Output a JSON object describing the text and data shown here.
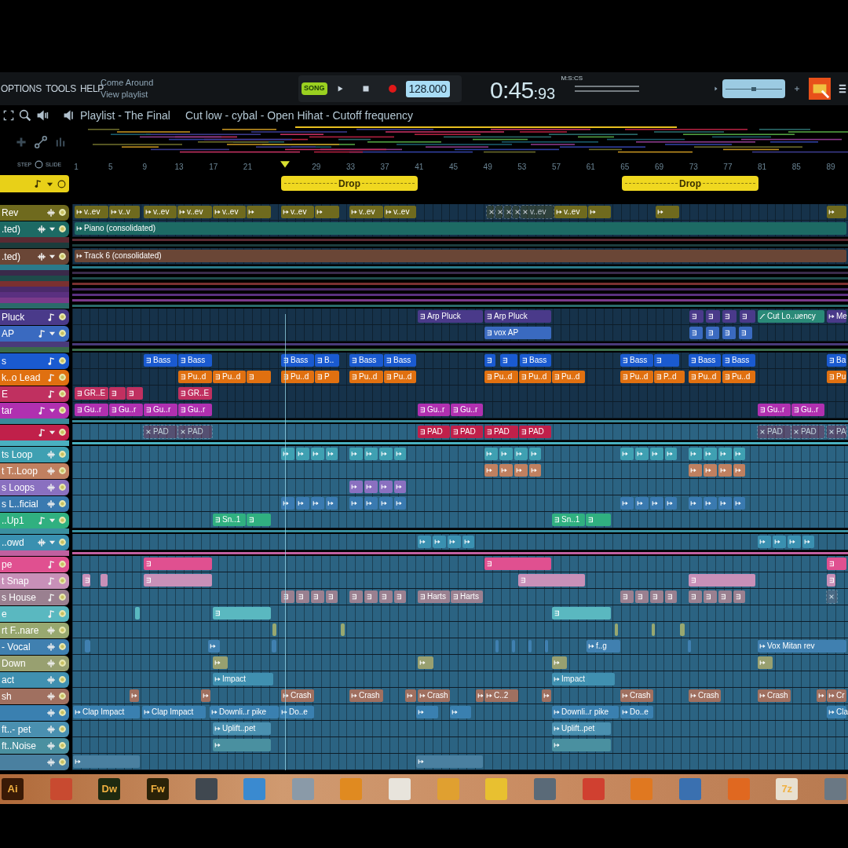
{
  "menu": [
    "OPTIONS",
    "TOOLS",
    "HELP"
  ],
  "hint": {
    "title": "Come Around",
    "subtitle": "View playlist"
  },
  "pitch": {
    "level": 0.5
  },
  "transport": {
    "mode": "SONG",
    "tempo": "128.000",
    "time": "0:45",
    "time_cs": ":93",
    "time_unit": "M:S:CS"
  },
  "playlist": {
    "title": "Playlist - The Final",
    "hint": "Cut low - cybal - Open Hihat - Cutoff frequency"
  },
  "ruler": {
    "step_label": "STEP",
    "slide_label": "SLIDE",
    "bars": [
      "1",
      "5",
      "9",
      "13",
      "17",
      "21",
      "29",
      "33",
      "37",
      "41",
      "45",
      "49",
      "53",
      "57",
      "61",
      "65",
      "69",
      "73",
      "77",
      "81",
      "85",
      "89"
    ]
  },
  "markers": [
    {
      "label": "Drop"
    },
    {
      "label": "Drop"
    }
  ],
  "tracks": [
    {
      "kind": "audio",
      "name": "Rev",
      "color": "#6f6a1e",
      "dropdown": false,
      "clips": [
        {
          "kind": "audio",
          "muted": false,
          "label": "v..ev"
        },
        {
          "kind": "audio",
          "muted": false,
          "label": "v..v"
        },
        {
          "kind": "audio",
          "muted": false,
          "label": "v..ev"
        },
        {
          "kind": "audio",
          "muted": false,
          "label": "v..ev"
        },
        {
          "kind": "audio",
          "muted": false,
          "label": "v..ev"
        },
        {
          "kind": "audio",
          "muted": false
        },
        {
          "kind": "audio",
          "muted": false,
          "label": "v..ev"
        },
        {
          "kind": "audio",
          "muted": false
        },
        {
          "kind": "audio",
          "muted": false,
          "label": "v..ev"
        },
        {
          "kind": "audio",
          "muted": false,
          "label": "v..ev"
        },
        {
          "kind": "audio",
          "muted": true
        },
        {
          "kind": "audio",
          "muted": true
        },
        {
          "kind": "audio",
          "muted": true
        },
        {
          "kind": "audio",
          "muted": true
        },
        {
          "kind": "audio",
          "muted": true,
          "label": "v..ev"
        },
        {
          "kind": "audio",
          "muted": false,
          "label": "v..ev"
        },
        {
          "kind": "audio",
          "muted": false
        },
        {
          "kind": "audio",
          "muted": false
        },
        {
          "kind": "audio",
          "muted": false
        }
      ]
    },
    {
      "kind": "audio",
      "name": ".ted)",
      "color": "#1d6a64",
      "dropdown": true,
      "clips": [
        {
          "kind": "audio",
          "muted": false,
          "label": "Piano (consolidated)"
        }
      ]
    },
    {
      "kind": "strip",
      "color": "#5a2a32"
    },
    {
      "kind": "strip",
      "color": "#1c3c3c"
    },
    {
      "kind": "audio",
      "name": ".ted)",
      "color": "#6a4636",
      "dropdown": true,
      "clips": [
        {
          "kind": "audio",
          "muted": false,
          "label": "Track 6 (consolidated)"
        }
      ]
    },
    {
      "kind": "strip",
      "color": "#2a7a8a"
    },
    {
      "kind": "strip",
      "color": "#3a2a4a"
    },
    {
      "kind": "strip",
      "color": "#1f4a4a"
    },
    {
      "kind": "strip",
      "color": "#7a3030"
    },
    {
      "kind": "strip",
      "color": "#4a2a6a"
    },
    {
      "kind": "strip",
      "color": "#5a3080"
    },
    {
      "kind": "strip",
      "color": "#7a3a8a"
    },
    {
      "kind": "strip",
      "color": "#2a6a6a"
    },
    {
      "kind": "pattern",
      "name": "Pluck",
      "color": "#4a3a8a",
      "dropdown": false,
      "clips": [
        {
          "kind": "pattern",
          "muted": false,
          "label": "Arp Pluck"
        },
        {
          "kind": "pattern",
          "muted": false,
          "label": "Arp Pluck"
        },
        {
          "kind": "pattern",
          "muted": false
        },
        {
          "kind": "pattern",
          "muted": false
        },
        {
          "kind": "pattern",
          "muted": false
        },
        {
          "kind": "pattern",
          "muted": false
        },
        {
          "kind": "automation",
          "muted": false,
          "label": "Cut Lo..uency"
        },
        {
          "kind": "audio",
          "muted": false,
          "label": "Me"
        }
      ]
    },
    {
      "kind": "pattern",
      "name": "AP",
      "color": "#3a6ac0",
      "dropdown": true,
      "clips": [
        {
          "kind": "pattern",
          "muted": false,
          "label": "vox AP"
        },
        {
          "kind": "pattern",
          "muted": false
        },
        {
          "kind": "pattern",
          "muted": false
        },
        {
          "kind": "pattern",
          "muted": false
        },
        {
          "kind": "pattern",
          "muted": false
        }
      ]
    },
    {
      "kind": "strip",
      "color": "#4a3a7a"
    },
    {
      "kind": "strip",
      "color": "#3a6a4a"
    },
    {
      "kind": "pattern",
      "name": "s",
      "color": "#1a5ad0",
      "dropdown": false,
      "clips": [
        {
          "kind": "pattern",
          "muted": false,
          "label": "Bass"
        },
        {
          "kind": "pattern",
          "muted": false,
          "label": "Bass"
        },
        {
          "kind": "pattern",
          "muted": false,
          "label": "Bass"
        },
        {
          "kind": "pattern",
          "muted": false,
          "label": "B.."
        },
        {
          "kind": "pattern",
          "muted": false,
          "label": "Bass"
        },
        {
          "kind": "pattern",
          "muted": false,
          "label": "Bass"
        },
        {
          "kind": "pattern",
          "muted": false
        },
        {
          "kind": "pattern",
          "muted": false
        },
        {
          "kind": "pattern",
          "muted": false,
          "label": "Bass"
        },
        {
          "kind": "pattern",
          "muted": false,
          "label": "Bass"
        },
        {
          "kind": "pattern",
          "muted": false
        },
        {
          "kind": "pattern",
          "muted": false,
          "label": "Bass"
        },
        {
          "kind": "pattern",
          "muted": false,
          "label": "Bass"
        },
        {
          "kind": "pattern",
          "muted": false,
          "label": "Ba"
        }
      ]
    },
    {
      "kind": "pattern",
      "name": "k..o Lead",
      "color": "#e07010",
      "dropdown": false,
      "clips": [
        {
          "kind": "pattern",
          "muted": false,
          "label": "Pu..d"
        },
        {
          "kind": "pattern",
          "muted": false,
          "label": "Pu..d"
        },
        {
          "kind": "pattern",
          "muted": false
        },
        {
          "kind": "pattern",
          "muted": false,
          "label": "Pu..d"
        },
        {
          "kind": "pattern",
          "muted": false,
          "label": "P"
        },
        {
          "kind": "pattern",
          "muted": false,
          "label": "Pu..d"
        },
        {
          "kind": "pattern",
          "muted": false,
          "label": "Pu..d"
        },
        {
          "kind": "pattern",
          "muted": false,
          "label": "Pu..d"
        },
        {
          "kind": "pattern",
          "muted": false,
          "label": "Pu..d"
        },
        {
          "kind": "pattern",
          "muted": false,
          "label": "Pu..d"
        },
        {
          "kind": "pattern",
          "muted": false,
          "label": "Pu..d"
        },
        {
          "kind": "pattern",
          "muted": false,
          "label": "P..d"
        },
        {
          "kind": "pattern",
          "muted": false,
          "label": "Pu..d"
        },
        {
          "kind": "pattern",
          "muted": false,
          "label": "Pu..d"
        },
        {
          "kind": "pattern",
          "muted": false,
          "label": "Pu"
        }
      ]
    },
    {
      "kind": "pattern",
      "name": "E",
      "color": "#c03060",
      "dropdown": false,
      "clips": [
        {
          "kind": "pattern",
          "muted": false,
          "label": "GR..E"
        },
        {
          "kind": "pattern",
          "muted": false
        },
        {
          "kind": "pattern",
          "muted": false
        },
        {
          "kind": "pattern",
          "muted": false,
          "label": "GR..E"
        }
      ]
    },
    {
      "kind": "pattern",
      "name": "tar",
      "color": "#b030b0",
      "dropdown": true,
      "clips": [
        {
          "kind": "pattern",
          "muted": false,
          "label": "Gu..r"
        },
        {
          "kind": "pattern",
          "muted": false,
          "label": "Gu..r"
        },
        {
          "kind": "pattern",
          "muted": false,
          "label": "Gu..r"
        },
        {
          "kind": "pattern",
          "muted": false,
          "label": "Gu..r"
        },
        {
          "kind": "pattern",
          "muted": false,
          "label": "Gu..r"
        },
        {
          "kind": "pattern",
          "muted": false,
          "label": "Gu..r"
        },
        {
          "kind": "pattern",
          "muted": false,
          "label": "Gu..r"
        },
        {
          "kind": "pattern",
          "muted": false,
          "label": "Gu..r"
        }
      ]
    },
    {
      "kind": "strip",
      "color": "#3a8a9a"
    },
    {
      "kind": "pattern",
      "color": "#c0204a",
      "dropdown": true,
      "clips": [
        {
          "kind": "pattern",
          "muted": true,
          "label": "PAD"
        },
        {
          "kind": "pattern",
          "muted": true,
          "label": "PAD"
        },
        {
          "kind": "pattern",
          "muted": false,
          "label": "PAD"
        },
        {
          "kind": "pattern",
          "muted": false,
          "label": "PAD"
        },
        {
          "kind": "pattern",
          "muted": false,
          "label": "PAD"
        },
        {
          "kind": "pattern",
          "muted": false,
          "label": "PAD"
        },
        {
          "kind": "pattern",
          "muted": true,
          "label": "PAD"
        },
        {
          "kind": "pattern",
          "muted": true,
          "label": "PAD"
        },
        {
          "kind": "pattern",
          "muted": true,
          "label": "PA"
        }
      ]
    },
    {
      "kind": "strip",
      "color": "#4ab0c0"
    },
    {
      "kind": "audio",
      "name": "ts Loop",
      "color": "#3fa0b2",
      "dropdown": false,
      "clips": [
        {
          "kind": "audio",
          "muted": false
        },
        {
          "kind": "audio",
          "muted": false
        },
        {
          "kind": "audio",
          "muted": false
        },
        {
          "kind": "audio",
          "muted": false
        },
        {
          "kind": "audio",
          "muted": false
        },
        {
          "kind": "audio",
          "muted": false
        },
        {
          "kind": "audio",
          "muted": false
        },
        {
          "kind": "audio",
          "muted": false
        },
        {
          "kind": "audio",
          "muted": false
        },
        {
          "kind": "audio",
          "muted": false
        },
        {
          "kind": "audio",
          "muted": false
        },
        {
          "kind": "audio",
          "muted": false
        },
        {
          "kind": "audio",
          "muted": false
        },
        {
          "kind": "audio",
          "muted": false
        },
        {
          "kind": "audio",
          "muted": false
        },
        {
          "kind": "audio",
          "muted": false
        },
        {
          "kind": "audio",
          "muted": false
        },
        {
          "kind": "audio",
          "muted": false
        },
        {
          "kind": "audio",
          "muted": false
        },
        {
          "kind": "audio",
          "muted": false
        }
      ]
    },
    {
      "kind": "audio",
      "name": "t T..Loop",
      "color": "#c08060",
      "dropdown": false,
      "clips": [
        {
          "kind": "audio",
          "muted": false
        },
        {
          "kind": "audio",
          "muted": false
        },
        {
          "kind": "audio",
          "muted": false
        },
        {
          "kind": "audio",
          "muted": false
        },
        {
          "kind": "audio",
          "muted": false
        },
        {
          "kind": "audio",
          "muted": false
        },
        {
          "kind": "audio",
          "muted": false
        },
        {
          "kind": "audio",
          "muted": false
        }
      ]
    },
    {
      "kind": "audio",
      "name": "s Loops",
      "color": "#8a70c0",
      "dropdown": false,
      "clips": [
        {
          "kind": "audio",
          "muted": false
        },
        {
          "kind": "audio",
          "muted": false
        },
        {
          "kind": "audio",
          "muted": false
        },
        {
          "kind": "audio",
          "muted": false
        }
      ]
    },
    {
      "kind": "audio",
      "name": "s L..ficial",
      "color": "#3a7ab0",
      "dropdown": false,
      "clips": [
        {
          "kind": "audio",
          "muted": false
        },
        {
          "kind": "audio",
          "muted": false
        },
        {
          "kind": "audio",
          "muted": false
        },
        {
          "kind": "audio",
          "muted": false
        },
        {
          "kind": "audio",
          "muted": false
        },
        {
          "kind": "audio",
          "muted": false
        },
        {
          "kind": "audio",
          "muted": false
        },
        {
          "kind": "audio",
          "muted": false
        },
        {
          "kind": "audio",
          "muted": false
        },
        {
          "kind": "audio",
          "muted": false
        },
        {
          "kind": "audio",
          "muted": false
        },
        {
          "kind": "audio",
          "muted": false
        },
        {
          "kind": "audio",
          "muted": false
        },
        {
          "kind": "audio",
          "muted": false
        },
        {
          "kind": "audio",
          "muted": false
        },
        {
          "kind": "audio",
          "muted": false
        }
      ]
    },
    {
      "kind": "pattern",
      "name": "..Up1",
      "color": "#30b080",
      "dropdown": true,
      "clips": [
        {
          "kind": "pattern",
          "muted": false,
          "label": "Sn..1"
        },
        {
          "kind": "pattern",
          "muted": false
        },
        {
          "kind": "pattern",
          "muted": false,
          "label": "Sn..1"
        },
        {
          "kind": "pattern",
          "muted": false
        }
      ]
    },
    {
      "kind": "strip",
      "color": "#3a90a0"
    },
    {
      "kind": "audio",
      "name": "..owd",
      "color": "#3a90b0",
      "dropdown": true,
      "clips": [
        {
          "kind": "audio",
          "muted": false
        },
        {
          "kind": "audio",
          "muted": false
        },
        {
          "kind": "audio",
          "muted": false
        },
        {
          "kind": "audio",
          "muted": false
        },
        {
          "kind": "audio",
          "muted": false
        },
        {
          "kind": "audio",
          "muted": false
        },
        {
          "kind": "audio",
          "muted": false
        },
        {
          "kind": "audio",
          "muted": false
        }
      ]
    },
    {
      "kind": "strip",
      "color": "#c060a0"
    },
    {
      "kind": "pattern",
      "name": "pe",
      "color": "#e05090",
      "dropdown": false,
      "clips": [
        {
          "kind": "pattern",
          "muted": false
        },
        {
          "kind": "pattern",
          "muted": false
        },
        {
          "kind": "pattern",
          "muted": false
        }
      ]
    },
    {
      "kind": "pattern",
      "name": "t Snap",
      "color": "#c890b8",
      "dropdown": false,
      "clips": [
        {
          "kind": "pattern",
          "muted": false
        },
        {
          "kind": "pattern",
          "muted": false
        },
        {
          "kind": "pattern",
          "muted": false
        },
        {
          "kind": "pattern",
          "muted": false
        },
        {
          "kind": "pattern",
          "muted": false
        },
        {
          "kind": "pattern",
          "muted": false
        }
      ]
    },
    {
      "kind": "pattern",
      "name": "s House",
      "color": "#9a8090",
      "dropdown": false,
      "clips": [
        {
          "kind": "pattern",
          "muted": false
        },
        {
          "kind": "pattern",
          "muted": false
        },
        {
          "kind": "pattern",
          "muted": false
        },
        {
          "kind": "pattern",
          "muted": false
        },
        {
          "kind": "pattern",
          "muted": false
        },
        {
          "kind": "pattern",
          "muted": false
        },
        {
          "kind": "pattern",
          "muted": false
        },
        {
          "kind": "pattern",
          "muted": false
        },
        {
          "kind": "pattern",
          "muted": false,
          "label": "Harts"
        },
        {
          "kind": "pattern",
          "muted": false,
          "label": "Harts"
        },
        {
          "kind": "pattern",
          "muted": false
        },
        {
          "kind": "pattern",
          "muted": false
        },
        {
          "kind": "pattern",
          "muted": false
        },
        {
          "kind": "pattern",
          "muted": false
        },
        {
          "kind": "pattern",
          "muted": false
        },
        {
          "kind": "pattern",
          "muted": false
        },
        {
          "kind": "pattern",
          "muted": false
        },
        {
          "kind": "pattern",
          "muted": false
        },
        {
          "kind": "pattern",
          "muted": true
        }
      ]
    },
    {
      "kind": "pattern",
      "name": "e",
      "color": "#5ab8c0",
      "dropdown": false,
      "clips": [
        {
          "kind": "pattern",
          "muted": false
        },
        {
          "kind": "pattern",
          "muted": false
        },
        {
          "kind": "pattern",
          "muted": false
        }
      ]
    },
    {
      "kind": "audio",
      "name": "rt F..nare",
      "color": "#98a870",
      "dropdown": false,
      "clips": [
        {
          "kind": "audio",
          "muted": false
        },
        {
          "kind": "audio",
          "muted": false
        },
        {
          "kind": "audio",
          "muted": false
        },
        {
          "kind": "audio",
          "muted": false
        },
        {
          "kind": "audio",
          "muted": false
        }
      ]
    },
    {
      "kind": "audio",
      "name": "- Vocal",
      "color": "#4080b0",
      "dropdown": false,
      "clips": [
        {
          "kind": "audio",
          "muted": false
        },
        {
          "kind": "audio",
          "muted": false
        },
        {
          "kind": "audio",
          "muted": false
        },
        {
          "kind": "audio",
          "muted": false
        },
        {
          "kind": "audio",
          "muted": false
        },
        {
          "kind": "audio",
          "muted": false
        },
        {
          "kind": "audio",
          "muted": false
        },
        {
          "kind": "audio",
          "muted": false,
          "label": "f..g"
        },
        {
          "kind": "audio",
          "muted": false
        },
        {
          "kind": "audio",
          "muted": false,
          "label": "Vox Mitan rev"
        }
      ]
    },
    {
      "kind": "audio",
      "name": "Down",
      "color": "#98a070",
      "dropdown": false,
      "clips": [
        {
          "kind": "audio",
          "muted": false
        },
        {
          "kind": "audio",
          "muted": false
        },
        {
          "kind": "audio",
          "muted": false
        },
        {
          "kind": "audio",
          "muted": false
        }
      ]
    },
    {
      "kind": "audio",
      "name": "act",
      "color": "#4090b0",
      "dropdown": false,
      "clips": [
        {
          "kind": "audio",
          "muted": false,
          "label": "Impact"
        },
        {
          "kind": "audio",
          "muted": false,
          "label": "Impact"
        }
      ]
    },
    {
      "kind": "audio",
      "name": "sh",
      "color": "#a07060",
      "dropdown": false,
      "clips": [
        {
          "kind": "audio",
          "muted": false
        },
        {
          "kind": "audio",
          "muted": false
        },
        {
          "kind": "audio",
          "muted": false,
          "label": "Crash"
        },
        {
          "kind": "audio",
          "muted": false,
          "label": "Crash"
        },
        {
          "kind": "audio",
          "muted": false
        },
        {
          "kind": "audio",
          "muted": false,
          "label": "Crash"
        },
        {
          "kind": "audio",
          "muted": false
        },
        {
          "kind": "audio",
          "muted": false,
          "label": "C..2"
        },
        {
          "kind": "audio",
          "muted": false
        },
        {
          "kind": "audio",
          "muted": false,
          "label": "Crash"
        },
        {
          "kind": "audio",
          "muted": false,
          "label": "Crash"
        },
        {
          "kind": "audio",
          "muted": false,
          "label": "Crash"
        },
        {
          "kind": "audio",
          "muted": false
        },
        {
          "kind": "audio",
          "muted": false,
          "label": "Cr"
        }
      ]
    },
    {
      "kind": "audio",
      "color": "#3a80b0",
      "dropdown": false,
      "clips": [
        {
          "kind": "audio",
          "muted": false,
          "label": "Clap Impact"
        },
        {
          "kind": "audio",
          "muted": false,
          "label": "Clap Impact"
        },
        {
          "kind": "audio",
          "muted": false,
          "label": "Downli..r pike"
        },
        {
          "kind": "audio",
          "muted": false,
          "label": "Do..e"
        },
        {
          "kind": "audio",
          "muted": false
        },
        {
          "kind": "audio",
          "muted": false
        },
        {
          "kind": "audio",
          "muted": false,
          "label": "Downli..r pike"
        },
        {
          "kind": "audio",
          "muted": false,
          "label": "Do..e"
        },
        {
          "kind": "audio",
          "muted": false,
          "label": "Cla"
        }
      ]
    },
    {
      "kind": "audio",
      "name": "ft..- pet",
      "color": "#4a90b0",
      "dropdown": false,
      "clips": [
        {
          "kind": "audio",
          "muted": false,
          "label": "Uplift..pet"
        },
        {
          "kind": "audio",
          "muted": false,
          "label": "Uplift..pet"
        }
      ]
    },
    {
      "kind": "audio",
      "name": "ft..Noise",
      "color": "#4a90a0",
      "dropdown": false,
      "clips": [
        {
          "kind": "audio",
          "muted": false
        },
        {
          "kind": "audio",
          "muted": false
        }
      ]
    },
    {
      "kind": "audio",
      "color": "#4a80a0",
      "dropdown": false,
      "clips": [
        {
          "kind": "audio",
          "muted": false
        },
        {
          "kind": "audio",
          "muted": false
        }
      ]
    }
  ],
  "taskbar": [
    {
      "label": "Ai",
      "color": "#3a1a06"
    },
    {
      "color": "#c84a30"
    },
    {
      "label": "Dw",
      "color": "#1e2a10"
    },
    {
      "label": "Fw",
      "color": "#2a2208"
    },
    {
      "color": "#404850"
    },
    {
      "color": "#3a8ad0"
    },
    {
      "color": "#8a9aa8"
    },
    {
      "color": "#e08a20"
    },
    {
      "color": "#e8e4dc"
    },
    {
      "color": "#e0a030"
    },
    {
      "color": "#e8c030"
    },
    {
      "color": "#5a6a78"
    },
    {
      "color": "#d04030"
    },
    {
      "color": "#e07820"
    },
    {
      "color": "#3a70b0"
    },
    {
      "color": "#e06820"
    },
    {
      "label": "7z",
      "color": "#e8e0d0"
    },
    {
      "color": "#6a7884"
    }
  ]
}
